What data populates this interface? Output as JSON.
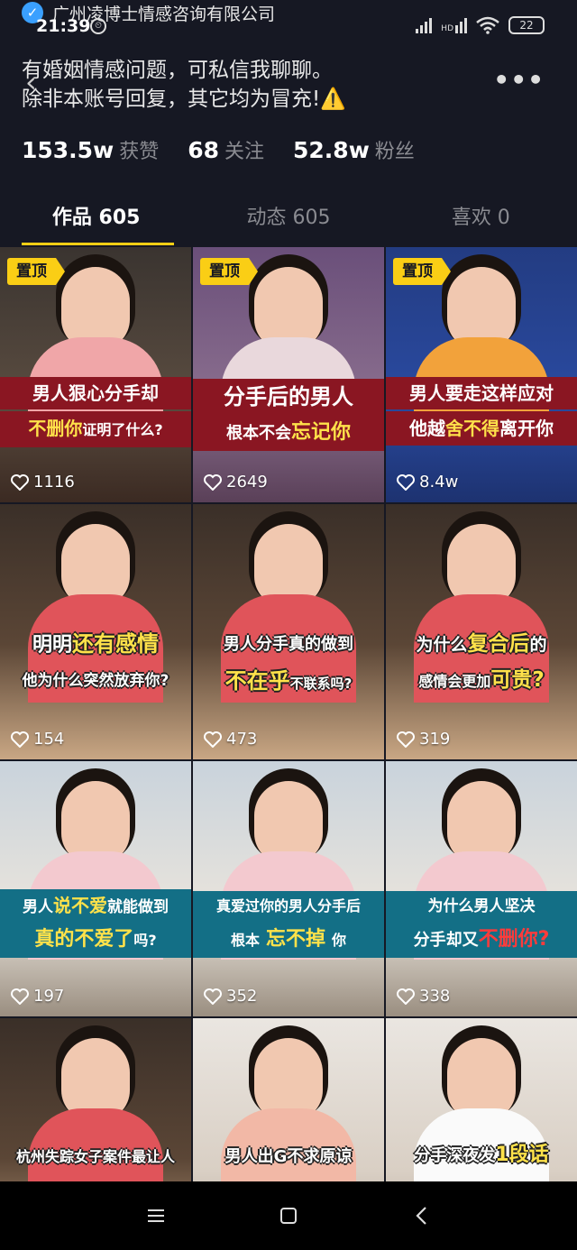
{
  "status_bar": {
    "company": "广州凌博士情感咨询有限公司",
    "time": "21:39",
    "battery": "22",
    "network_label": "HD"
  },
  "bio": {
    "line1": "有婚姻情感问题，可私信我聊聊。",
    "line2": "除非本账号回复，其它均为冒充!⚠️"
  },
  "stats": [
    {
      "num": "153.5w",
      "label": "获赞"
    },
    {
      "num": "68",
      "label": "关注"
    },
    {
      "num": "52.8w",
      "label": "粉丝"
    }
  ],
  "tabs": [
    {
      "label": "作品 605",
      "active": true
    },
    {
      "label": "动态 605",
      "active": false
    },
    {
      "label": "喜欢 0",
      "active": false
    }
  ],
  "pin_label": "置顶",
  "tiles": [
    {
      "pinned": true,
      "c1a": "男人狠心分手却",
      "c2a": "不删你",
      "c2b": "证明了什么?",
      "likes": "1116"
    },
    {
      "pinned": true,
      "c1a": "分手后的男人",
      "c2a": "根本不会",
      "c2b": "忘记你",
      "likes": "2649"
    },
    {
      "pinned": true,
      "c1a": "男人要走这样应对",
      "c2a": "他越",
      "c2b": "舍不得",
      "c2c": "离开你",
      "likes": "8.4w"
    },
    {
      "c1a": "明明",
      "c1b": "还有感情",
      "c2a": "他为什么突然放弃你?",
      "likes": "154"
    },
    {
      "c1a": "男人分手真的做到",
      "c2a": "不在乎",
      "c2b": "不联系吗?",
      "likes": "473"
    },
    {
      "c1a": "为什么",
      "c1b": "复合后",
      "c1c": "的",
      "c2a": "感情会更加",
      "c2b": "可贵?",
      "likes": "319"
    },
    {
      "c1a": "男人",
      "c1b": "说不爱",
      "c1c": "就能做到",
      "c2a": "真的不爱了",
      "c2b": "吗?",
      "likes": "197"
    },
    {
      "c1a": "真爱过你的男人分手后",
      "c2a": "根本",
      "c2b": "忘不掉",
      "c2c": "你",
      "likes": "352"
    },
    {
      "c1a": "为什么男人坚决",
      "c2a": "分手却又",
      "c2b": "不删你?",
      "likes": "338"
    },
    {
      "c1a": "杭州失踪女子案件最让人"
    },
    {
      "c1a": "男人出G不求原谅"
    },
    {
      "c1a": "分手深夜发",
      "c1b": "1段话"
    }
  ]
}
